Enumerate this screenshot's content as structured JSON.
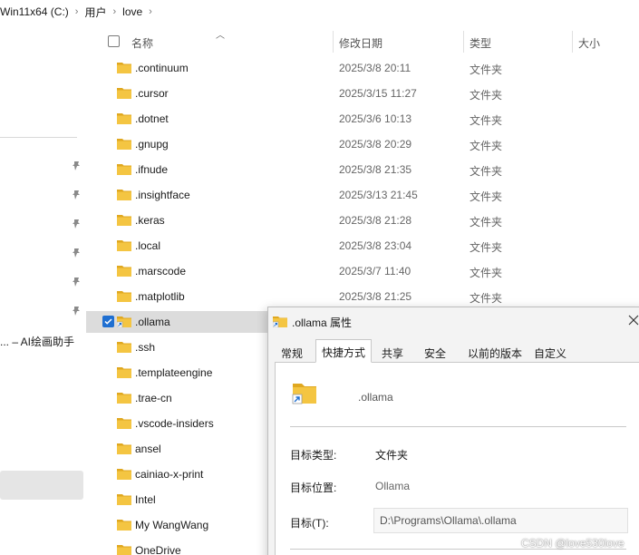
{
  "breadcrumb": {
    "items": [
      "Win11x64 (C:)",
      "用户",
      "love"
    ],
    "separator": "›"
  },
  "nav": {
    "truncated_item": "... – AI绘画助手"
  },
  "columns": {
    "name": "名称",
    "modified": "修改日期",
    "type": "类型",
    "size": "大小"
  },
  "files": [
    {
      "name": ".continuum",
      "date": "2025/3/8 20:11",
      "type": "文件夹",
      "selected": false
    },
    {
      "name": ".cursor",
      "date": "2025/3/15 11:27",
      "type": "文件夹",
      "selected": false
    },
    {
      "name": ".dotnet",
      "date": "2025/3/6 10:13",
      "type": "文件夹",
      "selected": false
    },
    {
      "name": ".gnupg",
      "date": "2025/3/8 20:29",
      "type": "文件夹",
      "selected": false
    },
    {
      "name": ".ifnude",
      "date": "2025/3/8 21:35",
      "type": "文件夹",
      "selected": false
    },
    {
      "name": ".insightface",
      "date": "2025/3/13 21:45",
      "type": "文件夹",
      "selected": false
    },
    {
      "name": ".keras",
      "date": "2025/3/8 21:28",
      "type": "文件夹",
      "selected": false
    },
    {
      "name": ".local",
      "date": "2025/3/8 23:04",
      "type": "文件夹",
      "selected": false
    },
    {
      "name": ".marscode",
      "date": "2025/3/7 11:40",
      "type": "文件夹",
      "selected": false
    },
    {
      "name": ".matplotlib",
      "date": "2025/3/8 21:25",
      "type": "文件夹",
      "selected": false
    },
    {
      "name": ".ollama",
      "date": "",
      "type": "",
      "selected": true
    },
    {
      "name": ".ssh",
      "date": "",
      "type": "",
      "selected": false
    },
    {
      "name": ".templateengine",
      "date": "",
      "type": "",
      "selected": false
    },
    {
      "name": ".trae-cn",
      "date": "",
      "type": "",
      "selected": false
    },
    {
      "name": ".vscode-insiders",
      "date": "",
      "type": "",
      "selected": false
    },
    {
      "name": "ansel",
      "date": "",
      "type": "",
      "selected": false
    },
    {
      "name": "cainiao-x-print",
      "date": "",
      "type": "",
      "selected": false
    },
    {
      "name": "Intel",
      "date": "",
      "type": "",
      "selected": false
    },
    {
      "name": "My WangWang",
      "date": "",
      "type": "",
      "selected": false
    },
    {
      "name": "OneDrive",
      "date": "",
      "type": "",
      "selected": false
    }
  ],
  "dialog": {
    "title": ".ollama 属性",
    "tabs": [
      "常规",
      "快捷方式",
      "共享",
      "安全",
      "以前的版本",
      "自定义"
    ],
    "active_tab": "快捷方式",
    "item_name": ".ollama",
    "target_type_label": "目标类型:",
    "target_type_value": "文件夹",
    "target_location_label": "目标位置:",
    "target_location_value": "Ollama",
    "target_label": "目标(T):",
    "target_value": "D:\\Programs\\Ollama\\.ollama"
  },
  "watermark": "CSDN @love530love",
  "colors": {
    "folder": "#f4c542",
    "folder_dark": "#e0a820",
    "checkbox_accent": "#1f6fd1",
    "selected_row": "#dcdcdc"
  }
}
